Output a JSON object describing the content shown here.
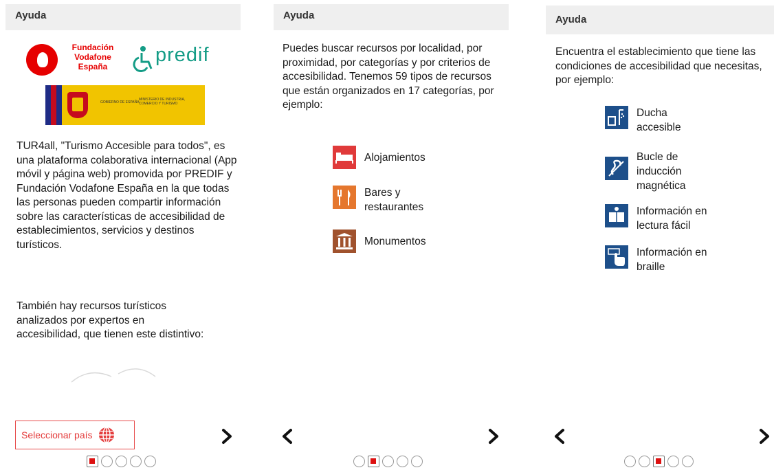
{
  "panels": [
    {
      "header": "Ayuda",
      "logos": {
        "vodafone_text": "Fundación Vodafone España",
        "predif_text": "predif",
        "gov_text_left": "GOBIERNO DE ESPAÑA",
        "gov_text_right": "MINISTERIO DE INDUSTRIA, COMERCIO Y TURISMO"
      },
      "paragraph1": "TUR4all, \"Turismo Accesible para todos\", es una plataforma colaborativa internacional (App móvil y página web) promovida por PREDIF y Fundación Vodafone España en la que todas las personas pueden compartir información sobre las características de accesibilidad de establecimientos, servicios y destinos turísticos.",
      "paragraph2": "También hay recursos turísticos analizados por expertos en accesibilidad, que tienen este distintivo:",
      "select_country_label": "Seleccionar país",
      "pager_active": 0
    },
    {
      "header": "Ayuda",
      "paragraph1": "Puedes buscar recursos por localidad, por proximidad, por categorías y por criterios de accesibilidad. Tenemos 59 tipos de recursos que están organizados en 17 categorías, por ejemplo:",
      "items": [
        {
          "label": "Alojamientos",
          "icon": "bed-icon"
        },
        {
          "label": "Bares y restaurantes",
          "icon": "fork-knife-icon"
        },
        {
          "label": "Monumentos",
          "icon": "monument-icon"
        }
      ],
      "pager_active": 1
    },
    {
      "header": "Ayuda",
      "paragraph1": "Encuentra el establecimiento que tiene las condiciones de accesibilidad que necesitas, por ejemplo:",
      "items": [
        {
          "label": "Ducha accesible",
          "icon": "accessible-shower-icon"
        },
        {
          "label": "Bucle de inducción magnética",
          "icon": "hearing-loop-icon"
        },
        {
          "label": "Información en lectura fácil",
          "icon": "easy-read-icon"
        },
        {
          "label": "Información en braille",
          "icon": "braille-icon"
        }
      ],
      "pager_active": 2
    }
  ],
  "colors": {
    "accent_red": "#e43c3c",
    "category_red": "#e03a3a",
    "category_orange": "#e5772e",
    "category_brown": "#a0522d",
    "accessibility_blue": "#1d4f8a",
    "predif_green": "#149c86"
  }
}
